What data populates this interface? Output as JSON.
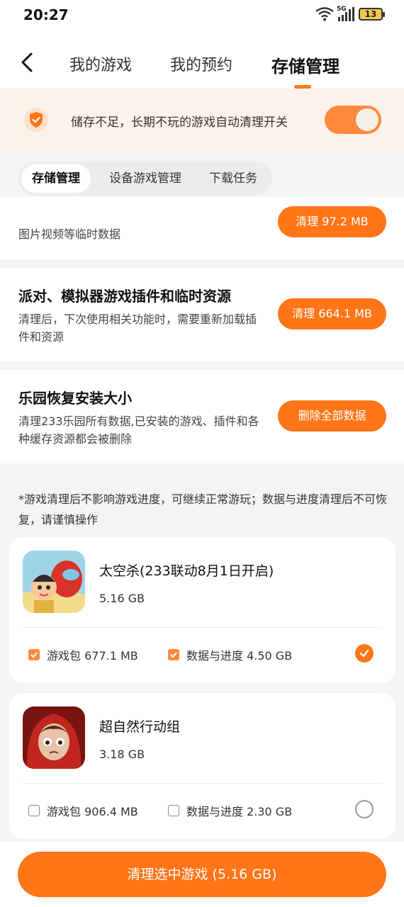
{
  "status_bar": {
    "time": "20:27",
    "network": "5G",
    "battery": "13"
  },
  "header": {
    "tabs": [
      {
        "label": "我的游戏"
      },
      {
        "label": "我的预约"
      },
      {
        "label": "存储管理"
      }
    ],
    "active_tab": "存储管理"
  },
  "banner": {
    "text": "储存不足，长期不玩的游戏自动清理开关",
    "toggle_on": true
  },
  "subtabs": [
    {
      "label": "存储管理"
    },
    {
      "label": "设备游戏管理"
    },
    {
      "label": "下载任务"
    }
  ],
  "sections": [
    {
      "title": "",
      "desc": "图片视频等临时数据",
      "button": "清理 97.2 MB"
    },
    {
      "title": "派对、模拟器游戏插件和临时资源",
      "desc": "清理后，下次使用相关功能时，需要重新加载插件和资源",
      "button": "清理 664.1 MB"
    },
    {
      "title": "乐园恢复安装大小",
      "desc": "清理233乐园所有数据,已安装的游戏、插件和各种缓存资源都会被删除",
      "button": "删除全部数据"
    }
  ],
  "notice": "*游戏清理后不影响游戏进度，可继续正常游玩；数据与进度清理后不可恢复，请谨慎操作",
  "games": [
    {
      "name": "太空杀(233联动8月1日开启)",
      "size": "5.16 GB",
      "package_label": "游戏包 677.1 MB",
      "data_label": "数据与进度 4.50 GB",
      "package_checked": true,
      "data_checked": true,
      "selected": true,
      "icon": "space-kill-game-icon"
    },
    {
      "name": "超自然行动组",
      "size": "3.18 GB",
      "package_label": "游戏包 906.4 MB",
      "data_label": "数据与进度 2.30 GB",
      "package_checked": false,
      "data_checked": false,
      "selected": false,
      "icon": "supernatural-game-icon"
    }
  ],
  "bottom": {
    "button": "清理选中游戏 (5.16 GB)"
  },
  "colors": {
    "accent": "#ff7518",
    "banner_bg": "#fdf2ea"
  }
}
